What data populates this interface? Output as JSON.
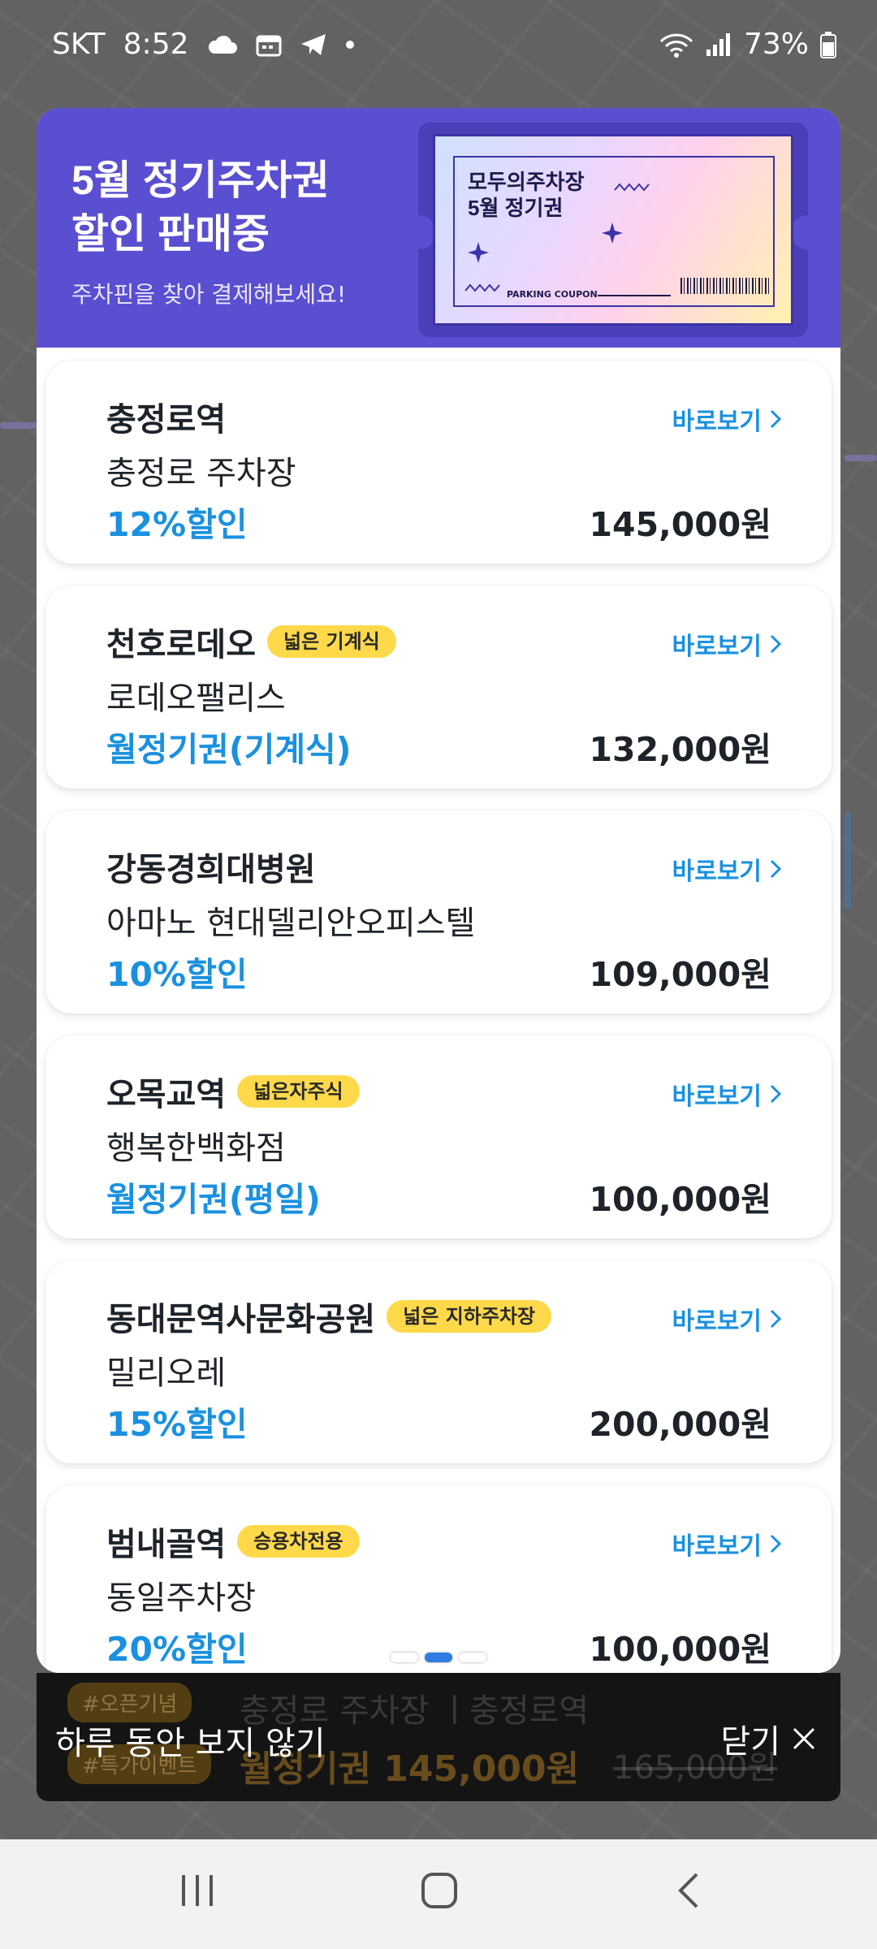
{
  "status_bar": {
    "carrier": "SKT",
    "time": "8:52",
    "battery": "73%",
    "icons": [
      "cloud-icon",
      "calendar-icon",
      "telegram-icon",
      "dot-icon",
      "wifi-icon",
      "signal-icon",
      "battery-icon"
    ]
  },
  "banner": {
    "title": "5월 정기주차권\n할인 판매중",
    "subtitle": "주차핀을 찾아 결제해보세요!",
    "ticket_title": "모두의주차장\n5월 정기권",
    "ticket_coupon": "PARKING COUPON"
  },
  "cards": [
    {
      "station": "충정로역",
      "badge": "",
      "lot": "충정로 주차장",
      "deal": "12%할인",
      "price": "145,000원",
      "view": "바로보기"
    },
    {
      "station": "천호로데오",
      "badge": "넓은 기계식",
      "lot": "로데오팰리스",
      "deal": "월정기권(기계식)",
      "price": "132,000원",
      "view": "바로보기"
    },
    {
      "station": "강동경희대병원",
      "badge": "",
      "lot": "아마노 현대델리안오피스텔",
      "deal": "10%할인",
      "price": "109,000원",
      "view": "바로보기"
    },
    {
      "station": "오목교역",
      "badge": "넓은자주식",
      "lot": "행복한백화점",
      "deal": "월정기권(평일)",
      "price": "100,000원",
      "view": "바로보기"
    },
    {
      "station": "동대문역사문화공원",
      "badge": "넓은 지하주차장",
      "lot": "밀리오레",
      "deal": "15%할인",
      "price": "200,000원",
      "view": "바로보기"
    },
    {
      "station": "범내골역",
      "badge": "승용차전용",
      "lot": "동일주차장",
      "deal": "20%할인",
      "price": "100,000원",
      "view": "바로보기"
    }
  ],
  "pager": {
    "count": 3,
    "active_index": 1
  },
  "background_promo": {
    "tag1": "#오픈기념",
    "tag2": "#특가이벤트",
    "line1": "충정로 주차장 ㅣ충정로역",
    "line2": "월정기권 145,000원",
    "old_price": "165,000원"
  },
  "footer": {
    "hide_today": "하루 동안 보지 않기",
    "close": "닫기"
  },
  "colors": {
    "banner": "#5a4fd0",
    "accent_blue": "#1a91e0",
    "badge_yellow": "#ffd94a",
    "text_dark": "#1e2329"
  }
}
